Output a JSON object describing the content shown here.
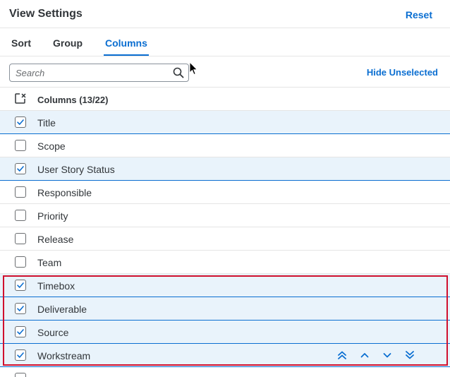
{
  "dialog": {
    "title": "View Settings",
    "reset_label": "Reset"
  },
  "tabs": [
    {
      "label": "Sort",
      "active": false
    },
    {
      "label": "Group",
      "active": false
    },
    {
      "label": "Columns",
      "active": true
    }
  ],
  "toolbar": {
    "search_placeholder": "Search",
    "search_value": "",
    "hide_unselected_label": "Hide Unselected"
  },
  "list": {
    "header_label": "Columns (13/22)",
    "rows": [
      {
        "label": "Title",
        "checked": true
      },
      {
        "label": "Scope",
        "checked": false
      },
      {
        "label": "User Story Status",
        "checked": true
      },
      {
        "label": "Responsible",
        "checked": false
      },
      {
        "label": "Priority",
        "checked": false
      },
      {
        "label": "Release",
        "checked": false
      },
      {
        "label": "Team",
        "checked": false
      },
      {
        "label": "Timebox",
        "checked": true
      },
      {
        "label": "Deliverable",
        "checked": true
      },
      {
        "label": "Source",
        "checked": true
      },
      {
        "label": "Workstream",
        "checked": true
      }
    ]
  },
  "colors": {
    "accent": "#0a6ed1",
    "selected_row_bg": "#e9f3fb",
    "highlight_border": "#d0102e",
    "text": "#32363a"
  },
  "icons": {
    "search": "magnifier-icon",
    "select_all": "select-all-icon",
    "move_top": "double-chevron-up-icon",
    "move_up": "chevron-up-icon",
    "move_down": "chevron-down-icon",
    "move_bottom": "double-chevron-down-icon"
  }
}
